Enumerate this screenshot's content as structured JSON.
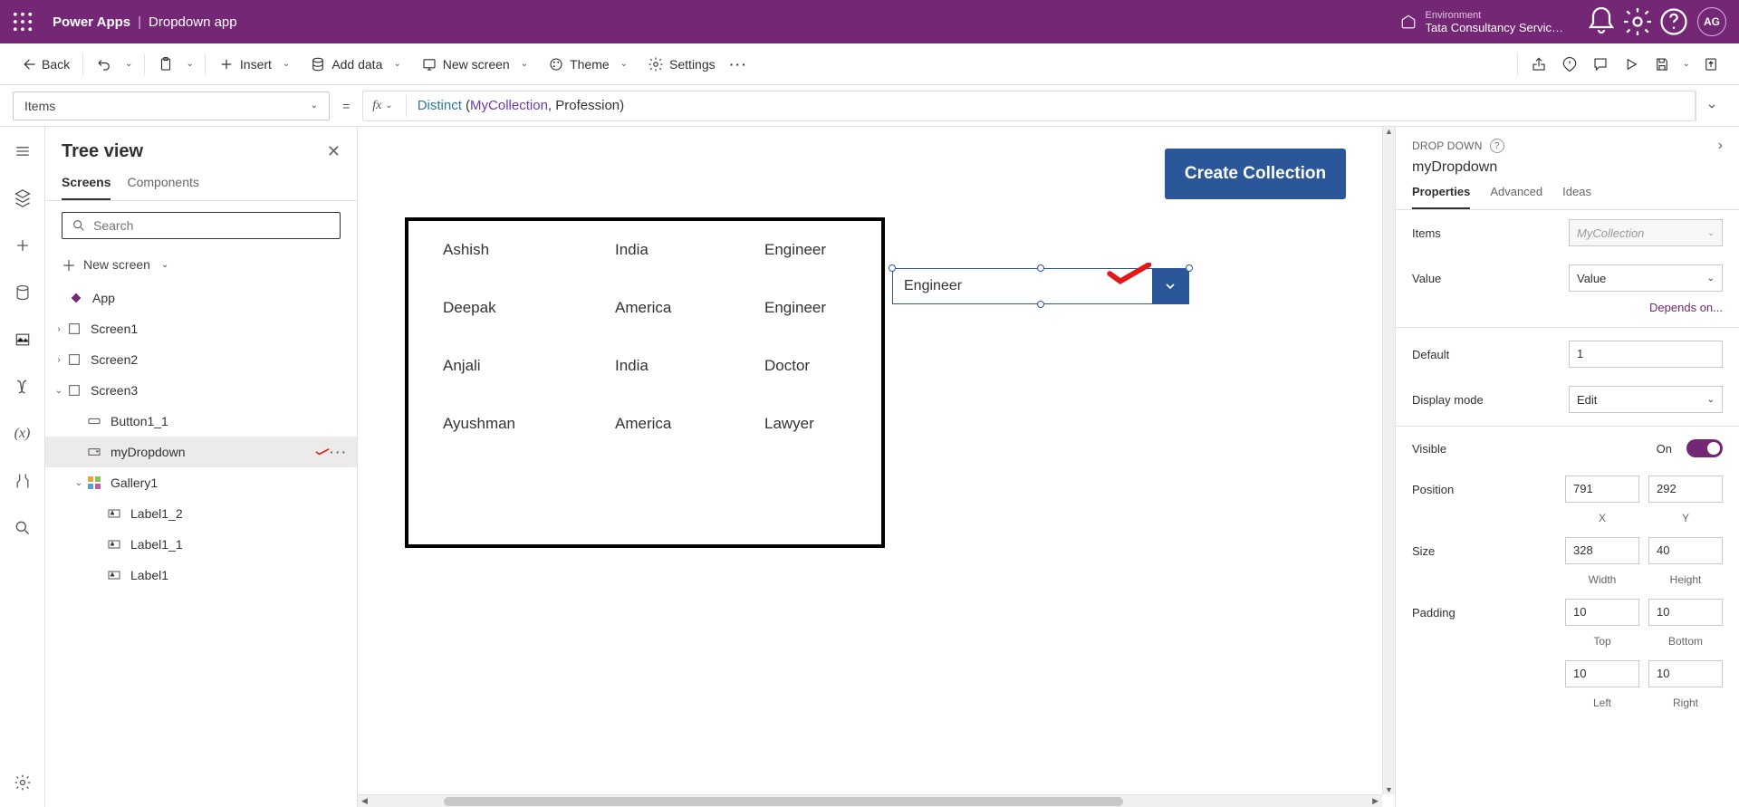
{
  "header": {
    "product": "Power Apps",
    "app": "Dropdown app",
    "env_label": "Environment",
    "env_value": "Tata Consultancy Servic…",
    "avatar": "AG"
  },
  "cmd": {
    "back": "Back",
    "insert": "Insert",
    "add_data": "Add data",
    "new_screen": "New screen",
    "theme": "Theme",
    "settings": "Settings"
  },
  "formula": {
    "property": "Items",
    "fn": "Distinct",
    "openp": " (",
    "var": "MyCollection",
    "rest": ", Profession)"
  },
  "tree": {
    "title": "Tree view",
    "tab_screens": "Screens",
    "tab_components": "Components",
    "search_placeholder": "Search",
    "new_screen": "New screen",
    "app": "App",
    "items": [
      {
        "label": "Screen1"
      },
      {
        "label": "Screen2"
      },
      {
        "label": "Screen3"
      },
      {
        "label": "Button1_1"
      },
      {
        "label": "myDropdown"
      },
      {
        "label": "Gallery1"
      },
      {
        "label": "Label1_2"
      },
      {
        "label": "Label1_1"
      },
      {
        "label": "Label1"
      }
    ]
  },
  "canvas": {
    "create_collection": "Create Collection",
    "dropdown_value": "Engineer",
    "rows": [
      {
        "c1": "Ashish",
        "c2": "India",
        "c3": "Engineer"
      },
      {
        "c1": "Deepak",
        "c2": "America",
        "c3": "Engineer"
      },
      {
        "c1": "Anjali",
        "c2": "India",
        "c3": "Doctor"
      },
      {
        "c1": "Ayushman",
        "c2": "America",
        "c3": "Lawyer"
      }
    ]
  },
  "props": {
    "type": "DROP DOWN",
    "name": "myDropdown",
    "tab_props": "Properties",
    "tab_adv": "Advanced",
    "tab_ideas": "Ideas",
    "items_label": "Items",
    "items_value": "MyCollection",
    "value_label": "Value",
    "value_value": "Value",
    "depends": "Depends on...",
    "default_label": "Default",
    "default_value": "1",
    "display_mode_label": "Display mode",
    "display_mode_value": "Edit",
    "visible_label": "Visible",
    "visible_state": "On",
    "position_label": "Position",
    "pos_x": "791",
    "pos_y": "292",
    "pos_x_lab": "X",
    "pos_y_lab": "Y",
    "size_label": "Size",
    "size_w": "328",
    "size_h": "40",
    "size_w_lab": "Width",
    "size_h_lab": "Height",
    "padding_label": "Padding",
    "pad_t": "10",
    "pad_b": "10",
    "pad_t_lab": "Top",
    "pad_b_lab": "Bottom",
    "pad_l": "10",
    "pad_r": "10",
    "pad_l_lab": "Left",
    "pad_r_lab": "Right"
  }
}
